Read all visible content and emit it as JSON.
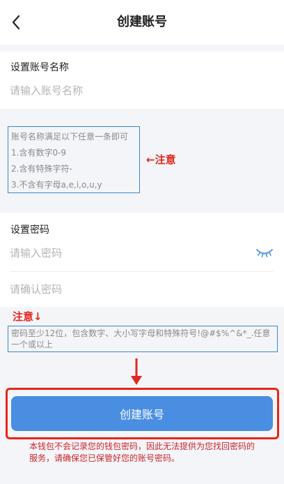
{
  "header": {
    "title": "创建账号",
    "back_icon": "chevron-left-icon"
  },
  "account_name": {
    "label": "设置账号名称",
    "placeholder": "请输入账号名称"
  },
  "name_rules": {
    "lines": [
      "账号名称满足以下任意一条即可",
      "1.含有数字0-9",
      "2.含有特殊字符-",
      "3.不含有字母a,e,i,o,u,y"
    ]
  },
  "annotations": {
    "note_right": "←注意",
    "note_down": "注意↓"
  },
  "password": {
    "label": "设置密码",
    "placeholder": "请输入密码",
    "confirm_placeholder": "请确认密码",
    "toggle_icon": "eye-closed-icon"
  },
  "password_hint": "密码至少12位，包含数字、大小写字母和特殊符号!@#$%^&*_.任意一个或以上",
  "create_button_label": "创建账号",
  "disclaimer": "本钱包不会记录您的钱包密码，因此无法提供为您找回密码的服务，请确保您已保管好您的账号密码。",
  "colors": {
    "primary": "#4a8ee2",
    "annotation_red": "#e0281e",
    "annotation_blue": "#3b86c9"
  }
}
